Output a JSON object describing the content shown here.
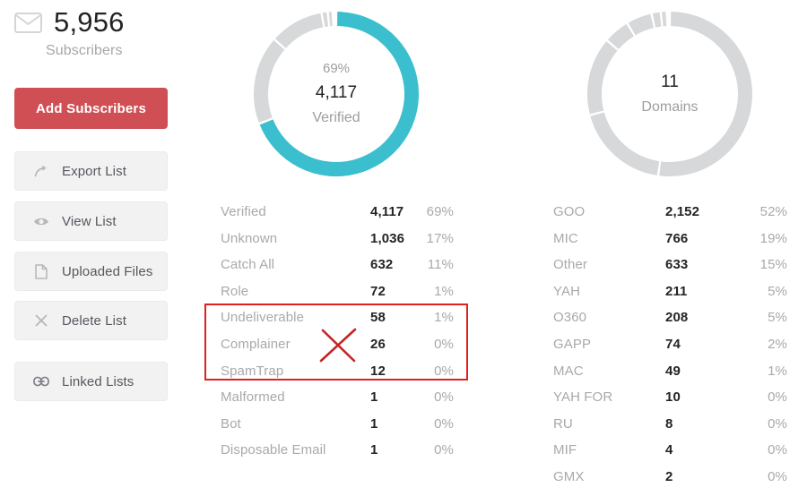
{
  "colors": {
    "accent_red": "#cf4f55",
    "teal": "#3bbfce",
    "donut_gray": "#d6d8d9",
    "annotation_red": "#e02020",
    "label_gray": "#a7a9ad",
    "value_dark": "#232427"
  },
  "sidebar": {
    "subscriber_count": "5,956",
    "subscriber_label": "Subscribers",
    "mail_icon": "envelope-icon",
    "add_button": "Add Subscribers",
    "buttons": [
      {
        "label": "Export List",
        "icon": "share-arrow-icon"
      },
      {
        "label": "View List",
        "icon": "eye-icon"
      },
      {
        "label": "Uploaded Files",
        "icon": "file-icon"
      },
      {
        "label": "Delete List",
        "icon": "close-x-icon"
      },
      {
        "label": "Linked Lists",
        "icon": "link-chain-icon"
      }
    ]
  },
  "verified_panel": {
    "donut": {
      "percent": "69%",
      "value": "4,117",
      "label": "Verified"
    },
    "rows": [
      {
        "label": "Verified",
        "value": "4,117",
        "percent": "69%"
      },
      {
        "label": "Unknown",
        "value": "1,036",
        "percent": "17%"
      },
      {
        "label": "Catch All",
        "value": "632",
        "percent": "11%"
      },
      {
        "label": "Role",
        "value": "72",
        "percent": "1%"
      },
      {
        "label": "Undeliverable",
        "value": "58",
        "percent": "1%"
      },
      {
        "label": "Complainer",
        "value": "26",
        "percent": "0%"
      },
      {
        "label": "SpamTrap",
        "value": "12",
        "percent": "0%"
      },
      {
        "label": "Malformed",
        "value": "1",
        "percent": "0%"
      },
      {
        "label": "Bot",
        "value": "1",
        "percent": "0%"
      },
      {
        "label": "Disposable Email",
        "value": "1",
        "percent": "0%"
      }
    ]
  },
  "domains_panel": {
    "donut": {
      "percent": "",
      "value": "11",
      "label": "Domains"
    },
    "rows": [
      {
        "label": "GOO",
        "value": "2,152",
        "percent": "52%"
      },
      {
        "label": "MIC",
        "value": "766",
        "percent": "19%"
      },
      {
        "label": "Other",
        "value": "633",
        "percent": "15%"
      },
      {
        "label": "YAH",
        "value": "211",
        "percent": "5%"
      },
      {
        "label": "O360",
        "value": "208",
        "percent": "5%"
      },
      {
        "label": "GAPP",
        "value": "74",
        "percent": "2%"
      },
      {
        "label": "MAC",
        "value": "49",
        "percent": "1%"
      },
      {
        "label": "YAH FOR",
        "value": "10",
        "percent": "0%"
      },
      {
        "label": "RU",
        "value": "8",
        "percent": "0%"
      },
      {
        "label": "MIF",
        "value": "4",
        "percent": "0%"
      },
      {
        "label": "GMX",
        "value": "2",
        "percent": "0%"
      }
    ]
  },
  "annotation": {
    "highlight_rows": [
      "Undeliverable",
      "Complainer",
      "SpamTrap"
    ],
    "mark": "red-x-mark"
  },
  "chart_data": [
    {
      "type": "pie",
      "title": "Verified",
      "center_value": 4117,
      "center_percent": 69,
      "center_label": "Verified",
      "categories": [
        "Verified",
        "Unknown",
        "Catch All",
        "Role",
        "Undeliverable",
        "Complainer",
        "SpamTrap",
        "Malformed",
        "Bot",
        "Disposable Email"
      ],
      "values": [
        4117,
        1036,
        632,
        72,
        58,
        26,
        12,
        1,
        1,
        1
      ],
      "percents": [
        69,
        17,
        11,
        1,
        1,
        0,
        0,
        0,
        0,
        0
      ],
      "highlight_index": 0,
      "highlight_color": "#3bbfce",
      "other_color": "#d6d8d9",
      "legend": "table-right"
    },
    {
      "type": "pie",
      "title": "Domains",
      "center_value": 11,
      "center_label": "Domains",
      "categories": [
        "GOO",
        "MIC",
        "Other",
        "YAH",
        "O360",
        "GAPP",
        "MAC",
        "YAH FOR",
        "RU",
        "MIF",
        "GMX"
      ],
      "values": [
        2152,
        766,
        633,
        211,
        208,
        74,
        49,
        10,
        8,
        4,
        2
      ],
      "percents": [
        52,
        19,
        15,
        5,
        5,
        2,
        1,
        0,
        0,
        0,
        0
      ],
      "other_color": "#d6d8d9",
      "legend": "table-right"
    }
  ]
}
